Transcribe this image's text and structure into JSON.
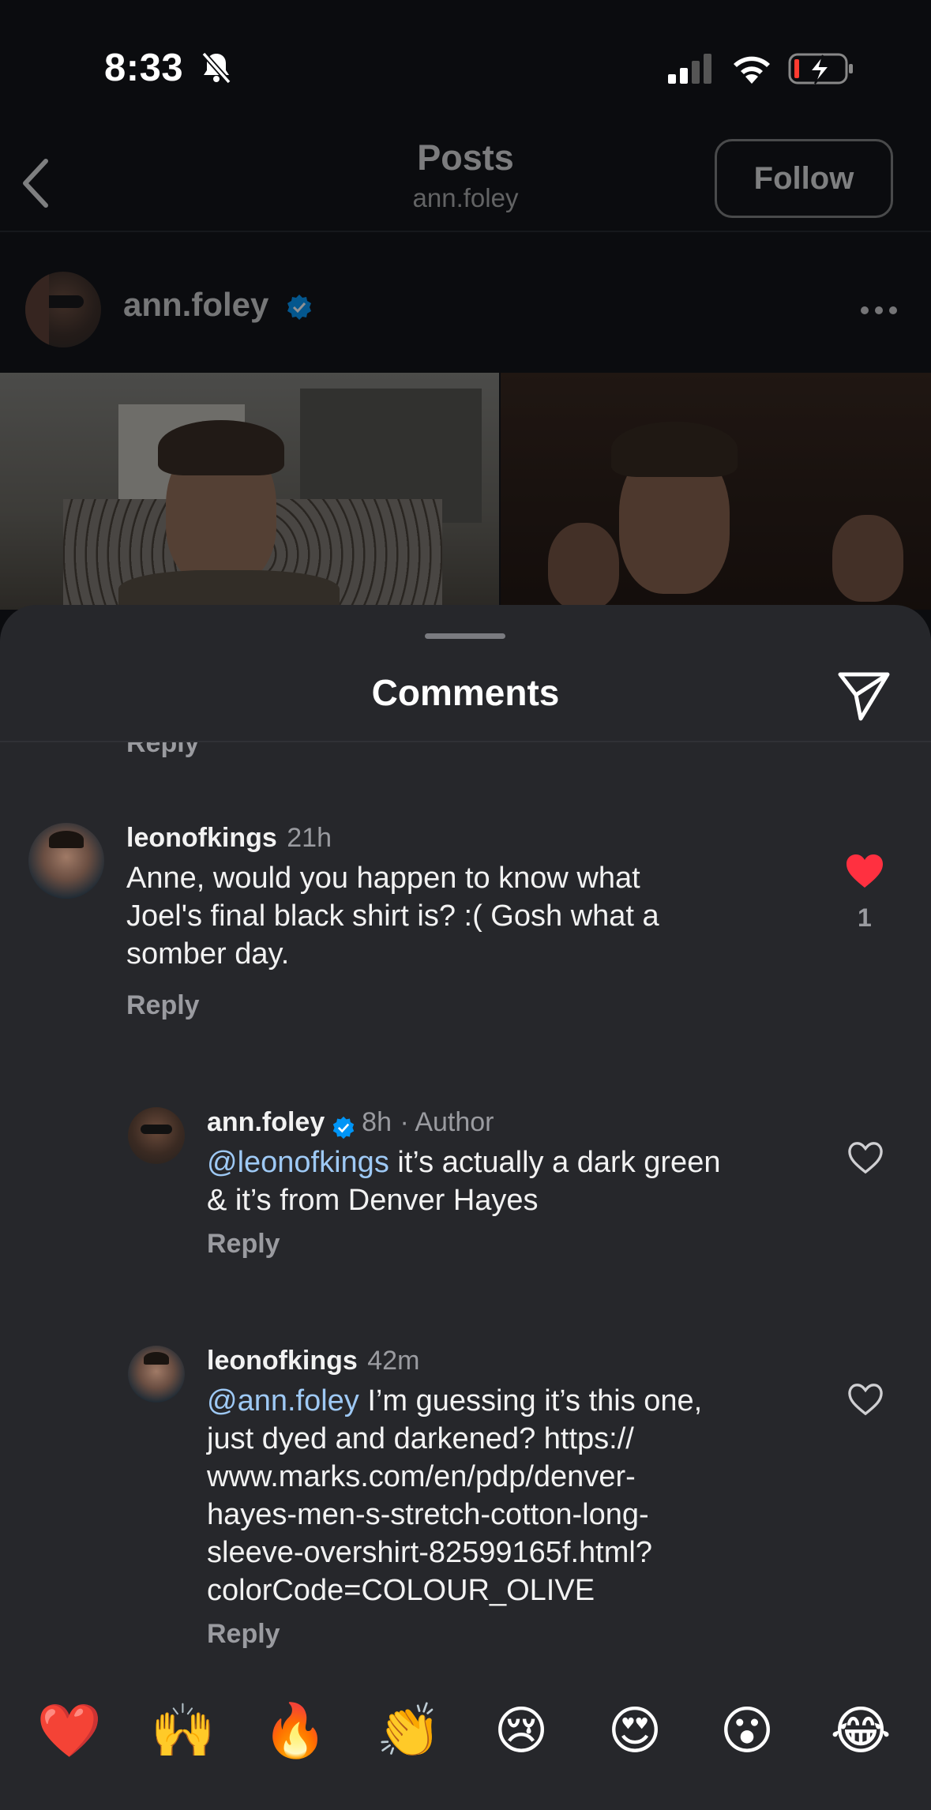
{
  "status_bar": {
    "time": "8:33"
  },
  "header": {
    "title": "Posts",
    "subtitle": "ann.foley",
    "follow_label": "Follow"
  },
  "post": {
    "author": "ann.foley"
  },
  "sheet": {
    "title": "Comments",
    "cut_reply": "Reply"
  },
  "comments": [
    {
      "username": "leonofkings",
      "time": "21h",
      "text_lines": [
        "Anne, would you happen to know what",
        "Joel's final black shirt is? :( Gosh what a",
        "somber day."
      ],
      "reply": "Reply",
      "liked": true,
      "likes": "1"
    },
    {
      "username": "ann.foley",
      "time": "8h",
      "badge": "· Author",
      "mention": "@leonofkings",
      "text_first": " it’s actually a dark green",
      "text_lines": [
        "& it’s from Denver Hayes"
      ],
      "reply": "Reply",
      "liked": false
    },
    {
      "username": "leonofkings",
      "time": "42m",
      "mention": "@ann.foley",
      "text_first": " I’m guessing it’s this one,",
      "text_lines": [
        "just dyed and darkened? https://",
        "www.marks.com/en/pdp/denver-",
        "hayes-men-s-stretch-cotton-long-",
        "sleeve-overshirt-82599165f.html?",
        "colorCode=COLOUR_OLIVE"
      ],
      "reply": "Reply",
      "liked": false
    }
  ],
  "emojis": [
    "❤️",
    "🙌",
    "🔥",
    "👏",
    "😢",
    "😍",
    "😮",
    "😂"
  ],
  "colors": {
    "like_red": "#ff3040",
    "mention_blue": "#9ec9f5",
    "verified_blue": "#0095f6",
    "sheet_bg": "#26272b"
  }
}
